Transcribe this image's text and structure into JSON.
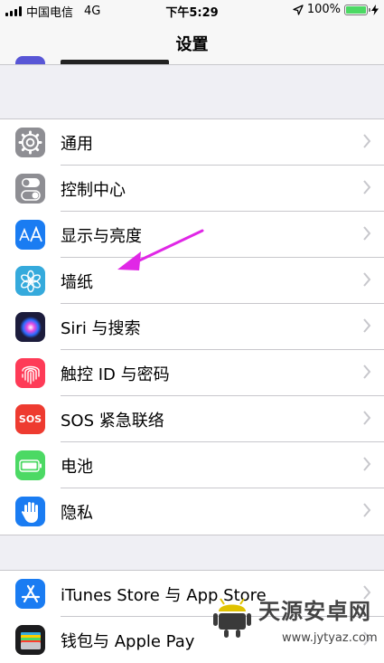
{
  "status_bar": {
    "carrier": "中国电信",
    "network": "4G",
    "time": "下午5:29",
    "battery_percent": "100%",
    "battery_level": 1.0
  },
  "nav": {
    "title": "设置"
  },
  "colors": {
    "general": "#8e8e93",
    "control_center": "#8e8e93",
    "display": "#1a7cf2",
    "wallpaper": "#35aadc",
    "siri": "#1c1c3c",
    "touch_id": "#fe3b57",
    "sos": "#ee3b30",
    "battery": "#4cd964",
    "privacy": "#1a7cf2",
    "app_store": "#1a7cf2",
    "wallet": "#1c1c1e",
    "annotation_arrow": "#e027e6"
  },
  "settings_group_1": [
    {
      "label": "通用",
      "icon": "gear-icon"
    },
    {
      "label": "控制中心",
      "icon": "toggles-icon"
    },
    {
      "label": "显示与亮度",
      "icon": "text-size-icon"
    },
    {
      "label": "墙纸",
      "icon": "flower-icon"
    },
    {
      "label": "Siri 与搜索",
      "icon": "siri-icon"
    },
    {
      "label": "触控 ID 与密码",
      "icon": "fingerprint-icon"
    },
    {
      "label": "SOS 紧急联络",
      "icon": "sos-icon",
      "icon_text": "SOS"
    },
    {
      "label": "电池",
      "icon": "battery-icon"
    },
    {
      "label": "隐私",
      "icon": "hand-icon"
    }
  ],
  "settings_group_2": [
    {
      "label": "iTunes Store 与 App Store",
      "icon": "app-store-icon"
    },
    {
      "label": "钱包与 Apple Pay",
      "icon": "wallet-icon"
    }
  ],
  "watermark": {
    "title": "天源安卓网",
    "url": "www.jytyaz.com"
  }
}
